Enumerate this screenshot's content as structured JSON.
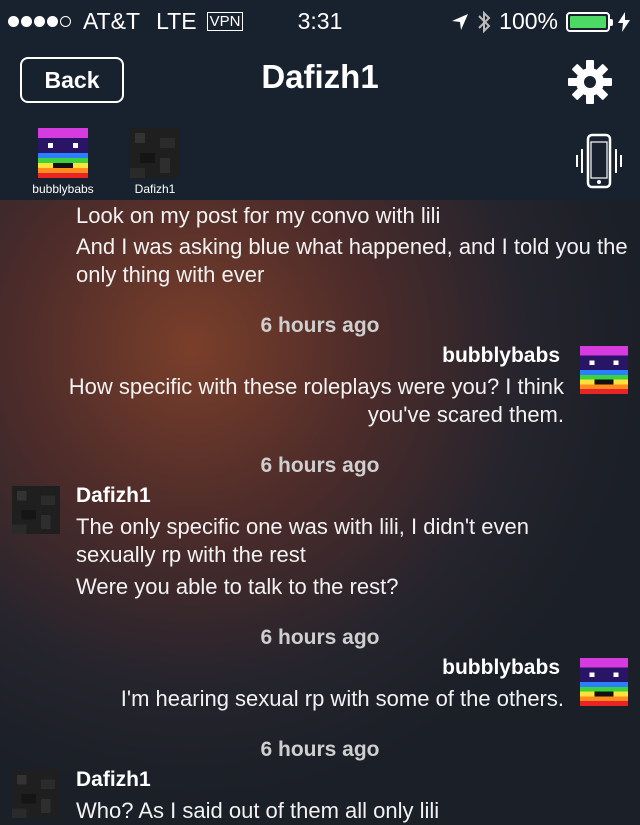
{
  "status_bar": {
    "carrier": "AT&T",
    "network": "LTE",
    "vpn": "VPN",
    "time": "3:31",
    "battery": "100%",
    "signal_bars": 4,
    "battery_level": 1.0
  },
  "nav": {
    "back_label": "Back",
    "title": "Dafizh1",
    "settings_icon": "gear-icon"
  },
  "participants": [
    {
      "name": "bubblybabs",
      "avatar": "rainbow-pixel-avatar"
    },
    {
      "name": "Dafizh1",
      "avatar": "dark-pixel-avatar"
    }
  ],
  "phone_icon": "phone-vibrate-icon",
  "messages": {
    "continuation": [
      "Look on my post for my convo with lili",
      "And I was asking blue what happened, and I told you the only thing with ever"
    ],
    "group1": {
      "time": "6 hours ago",
      "sender": "bubblybabs",
      "lines": [
        "How specific with these roleplays were you?  I think you've scared them."
      ]
    },
    "group2": {
      "time": "6 hours ago",
      "sender": "Dafizh1",
      "lines": [
        "The only specific one was with lili, I didn't even sexually rp with the rest",
        "Were you able to talk to the rest?"
      ]
    },
    "group3": {
      "time": "6 hours ago",
      "sender": "bubblybabs",
      "lines": [
        "I'm hearing sexual rp with some of the others."
      ]
    },
    "group4": {
      "time": "6 hours ago",
      "sender": "Dafizh1",
      "lines": [
        "Who? As I said out of them all only lili"
      ]
    }
  },
  "colors": {
    "header_bg": "#18222e",
    "battery_green": "#4cd964",
    "timestamp": "#cfcfcf"
  }
}
